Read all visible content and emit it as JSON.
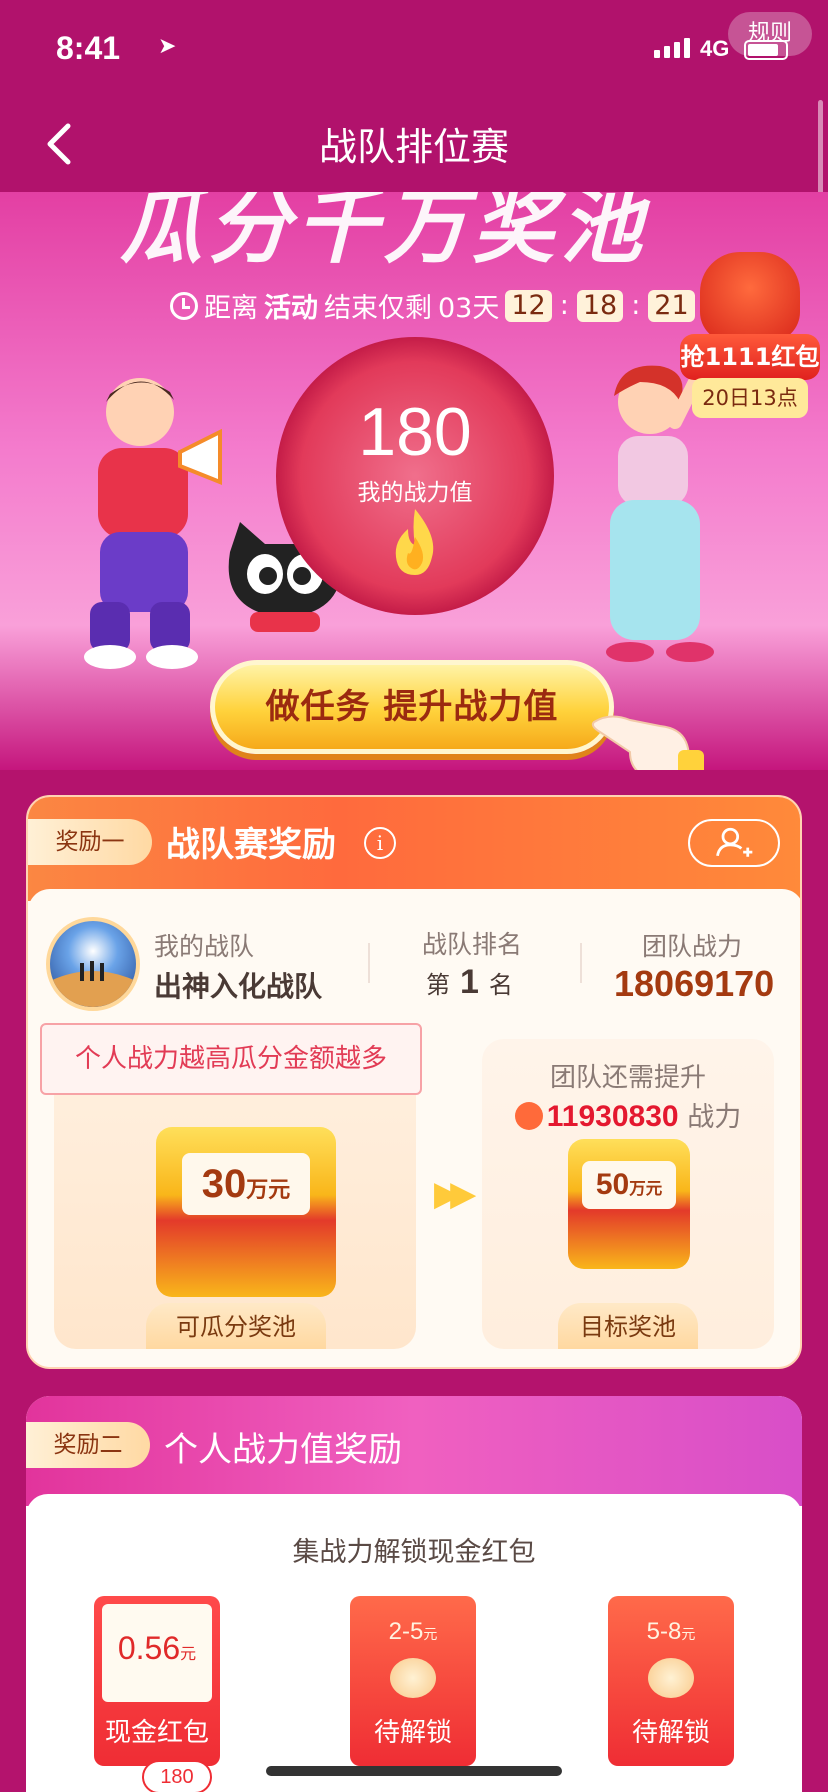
{
  "status_bar": {
    "time": "8:41",
    "network": "4G",
    "rules_button": "规则"
  },
  "nav": {
    "title": "战队排位赛"
  },
  "banner": {
    "headline": "瓜分千万奖池",
    "countdown_prefix": "距离",
    "countdown_bold": "活动",
    "countdown_mid": "结束仅剩",
    "days": "03天",
    "hours": "12",
    "minutes": "18",
    "seconds": "21",
    "my_power_value": "180",
    "my_power_label": "我的战力值",
    "red_packet_title": "抢1111红包",
    "red_packet_time": "20日13点",
    "task_button": "做任务 提升战力值"
  },
  "reward1": {
    "tag": "奖励一",
    "title": "战队赛奖励",
    "info_icon": "i",
    "my_team_label": "我的战队",
    "my_team_name": "出神入化战队",
    "rank_label": "战队排名",
    "rank_prefix": "第",
    "rank_value": "1",
    "rank_suffix": "名",
    "team_power_label": "团队战力",
    "team_power_value": "18069170",
    "tip": "个人战力越高瓜分金额越多",
    "need_label": "团队还需提升",
    "need_value": "11930830",
    "need_unit": "战力",
    "pool_current_amount": "30",
    "pool_current_unit": "万元",
    "pool_current_label": "可瓜分奖池",
    "pool_target_amount": "50",
    "pool_target_unit": "万元",
    "pool_target_label": "目标奖池"
  },
  "reward2": {
    "tag": "奖励二",
    "title": "个人战力值奖励",
    "subtitle": "集战力解锁现金红包",
    "packets": [
      {
        "amount": "0.56",
        "unit": "元",
        "state": "现金红包",
        "badge": "180"
      },
      {
        "amount": "2-5",
        "unit": "元",
        "state": "待解锁"
      },
      {
        "amount": "5-8",
        "unit": "元",
        "state": "待解锁"
      }
    ]
  },
  "colors": {
    "page_bg": "#b4136d",
    "accent_orange": "#ff6a3d",
    "gold": "#ffd23b",
    "red": "#ef2d34"
  }
}
